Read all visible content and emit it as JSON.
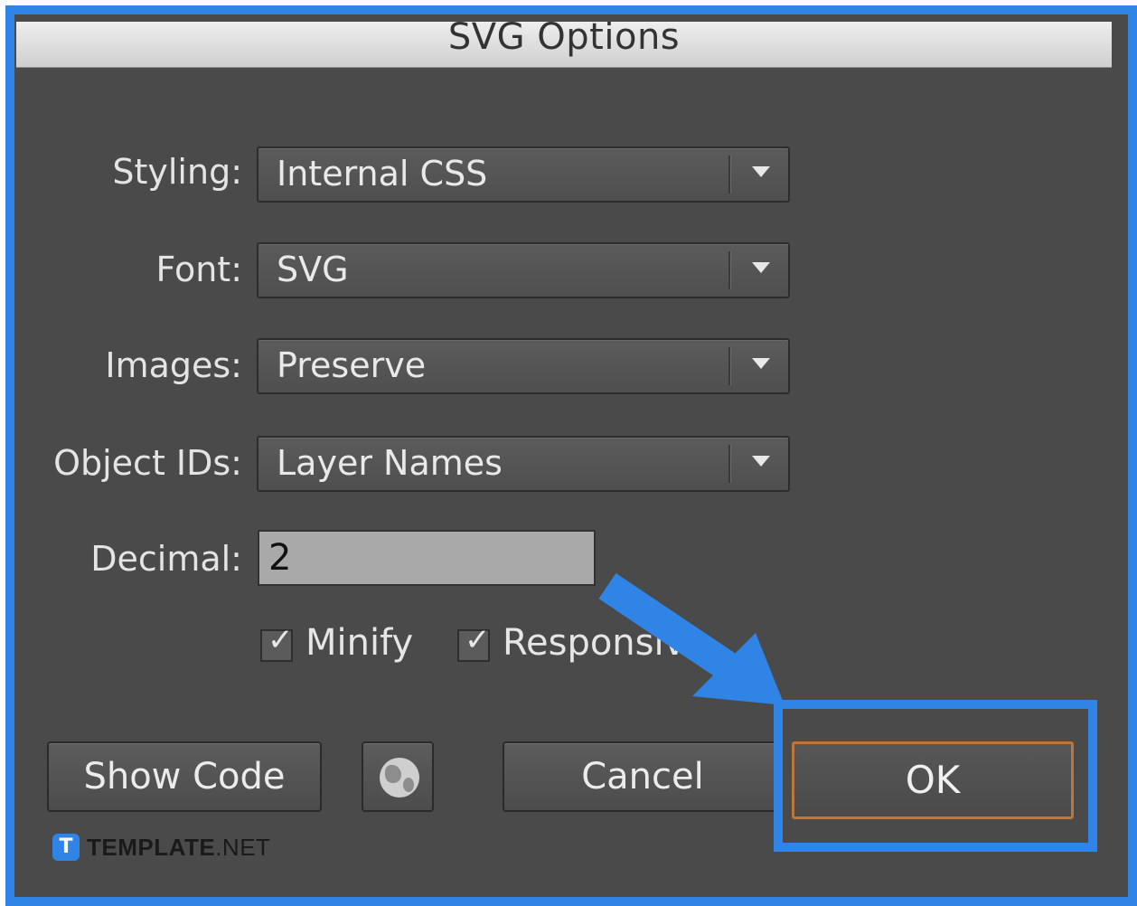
{
  "dialog": {
    "title": "SVG Options"
  },
  "fields": [
    {
      "label": "Styling:",
      "value": "Internal CSS"
    },
    {
      "label": "Font:",
      "value": "SVG"
    },
    {
      "label": "Images:",
      "value": "Preserve"
    },
    {
      "label": "Object IDs:",
      "value": "Layer Names"
    }
  ],
  "decimal": {
    "label": "Decimal:",
    "value": "2"
  },
  "checkboxes": [
    {
      "label": "Minify",
      "checked": true
    },
    {
      "label": "Responsive",
      "checked": true
    }
  ],
  "buttons": {
    "show_code": "Show Code",
    "globe_icon": "globe-icon",
    "cancel": "Cancel",
    "ok": "OK"
  },
  "watermark": {
    "logo_letter": "T",
    "brand": "TEMPLATE",
    "suffix": ".NET"
  },
  "colors": {
    "highlight": "#2f84e6",
    "dialog_bg": "#4a4a4a",
    "ok_border": "#b9773c"
  }
}
